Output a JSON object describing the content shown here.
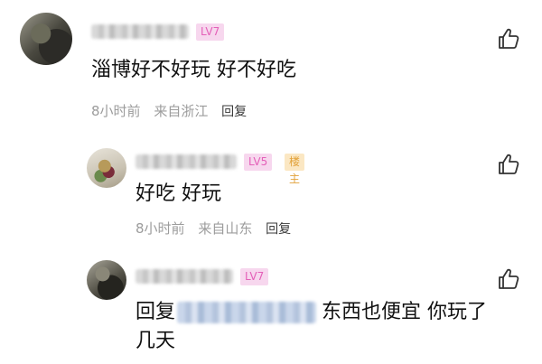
{
  "comments": [
    {
      "level": "LV7",
      "text": "淄博好不好玩 好不好吃",
      "time": "8小时前",
      "location": "来自浙江",
      "reply": "回复"
    },
    {
      "level": "LV5",
      "owner_badge": "楼主",
      "text": "好吃 好玩",
      "time": "8小时前",
      "location": "来自山东",
      "reply": "回复"
    },
    {
      "level": "LV7",
      "reply_prefix": "回复",
      "text_after_mention": "东西也便宜 你玩了",
      "text_line2": "几天"
    }
  ],
  "icons": {
    "like": "thumbs-up-icon"
  },
  "colors": {
    "level_badge_bg": "#f7d7ee",
    "level_badge_text": "#e45fb8",
    "owner_badge_bg": "#fbe7c3",
    "owner_badge_text": "#e2a23a",
    "meta_text": "#9c9c9c"
  }
}
